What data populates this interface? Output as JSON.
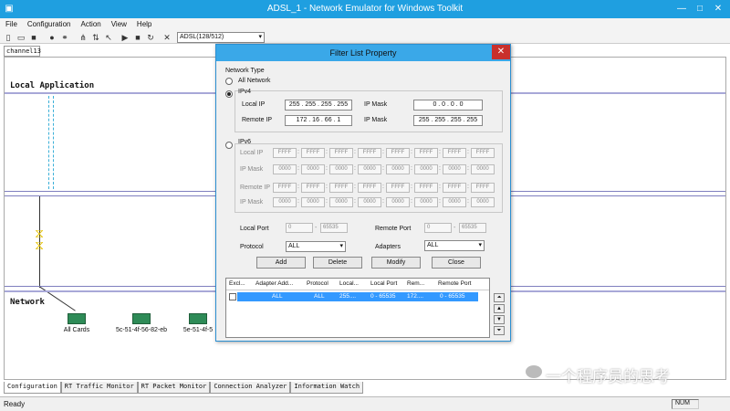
{
  "window": {
    "title": "ADSL_1 - Network Emulator for Windows Toolkit"
  },
  "menu": [
    "File",
    "Configuration",
    "Action",
    "View",
    "Help"
  ],
  "toolbar": {
    "icons": [
      "new-icon",
      "open-icon",
      "save-icon",
      "globe-icon",
      "link-icon",
      "network-icon",
      "flow-icon",
      "cursor-icon",
      "play-icon",
      "stop-icon",
      "refresh-icon",
      "delete-icon"
    ],
    "profile": "ADSL(128/512)"
  },
  "channel_tab": "channel13",
  "canvas": {
    "local_label": "Local Application",
    "network_label": "Network",
    "adapters": [
      "All Cards",
      "5c-51-4f-56-82-eb",
      "5e-51-4f-5"
    ]
  },
  "dialog": {
    "title": "Filter List Property",
    "network_type_label": "Network Type",
    "all_network": "All Network",
    "ipv4": "IPv4",
    "ipv6": "IPv6",
    "local_ip_label": "Local IP",
    "remote_ip_label": "Remote IP",
    "ip_mask_label": "IP Mask",
    "local_ip": "255 . 255 . 255 . 255",
    "local_mask": "0 . 0 . 0 . 0",
    "remote_ip": "172 . 16 . 66 . 1",
    "remote_mask": "255 . 255 . 255 . 255",
    "ipv6_ffff": "FFFF",
    "ipv6_zero": "0000",
    "local_port_label": "Local Port",
    "remote_port_label": "Remote Port",
    "port_from": "0",
    "port_dash": "-",
    "port_to": "65535",
    "protocol_label": "Protocol",
    "protocol_value": "ALL",
    "adapters_label": "Adapters",
    "adapters_value": "ALL",
    "buttons": {
      "add": "Add",
      "delete": "Delete",
      "modify": "Modify",
      "close": "Close"
    },
    "list": {
      "headers": [
        "Excl...",
        "Adapter Add...",
        "Protocol",
        "Local...",
        "Local Port",
        "Rem...",
        "Remote Port"
      ],
      "row": [
        "ALL",
        "ALL",
        "255....",
        "0 - 65535",
        "172....",
        "0 - 65535"
      ]
    }
  },
  "bottom_tabs": [
    "Configuration",
    "RT Traffic Monitor",
    "RT Packet Monitor",
    "Connection Analyzer",
    "Information Watch"
  ],
  "status": {
    "ready": "Ready",
    "num": "NUM"
  },
  "watermark": "一个程序员的思考"
}
